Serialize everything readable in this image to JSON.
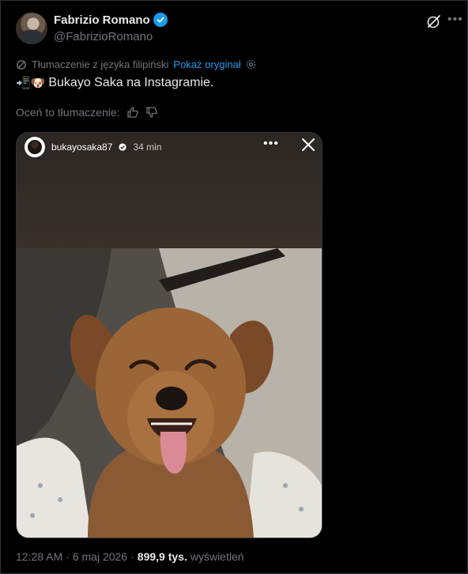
{
  "author": {
    "name": "Fabrizio Romano",
    "handle": "@FabrizioRomano"
  },
  "icons": {
    "verified": "verified-badge-icon",
    "grok": "grok-icon",
    "more": "more-options-icon",
    "translate": "translate-icon",
    "settings": "settings-gear-icon",
    "thumbs_up": "thumbs-up-icon",
    "thumbs_down": "thumbs-down-icon",
    "close": "close-icon"
  },
  "translation": {
    "label": "Tłumaczenie z języka filipiński",
    "show_original": "Pokaż oryginał"
  },
  "tweet": {
    "emojis": "📲🐶",
    "text": "Bukayo Saka na Instagramie."
  },
  "rate": {
    "label": "Oceń to tłumaczenie:"
  },
  "story": {
    "username": "bukayosaka87",
    "time": "34 min",
    "more": "•••"
  },
  "meta": {
    "time": "12:28 AM",
    "separator1": "·",
    "date": "6 maj 2026",
    "separator2": "·",
    "views": "899,9 tys.",
    "views_label": "wyświetleń"
  },
  "colors": {
    "background": "#000000",
    "text": "#e7e9ea",
    "muted": "#71767b",
    "accent": "#1d9bf0",
    "border": "#2f3336"
  }
}
